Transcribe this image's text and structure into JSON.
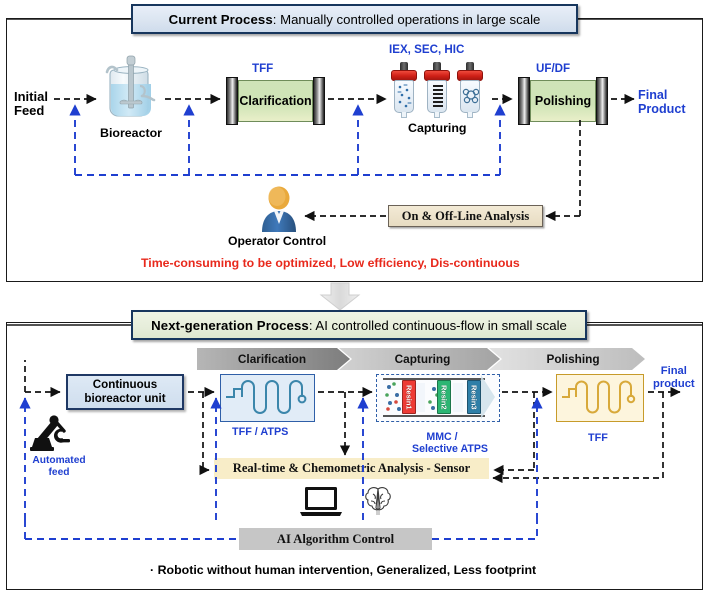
{
  "figure": {
    "title_top": "Current Process",
    "title_bottom": "Next-generation Process"
  },
  "top_panel": {
    "banner": {
      "title": "Current Process",
      "subtitle": ": Manually controlled operations in large scale"
    },
    "initial_feed": "Initial\nFeed",
    "initial_feed_line1": "Initial",
    "initial_feed_line2": "Feed",
    "bioreactor_label": "Bioreactor",
    "clarification": {
      "tag": "TFF",
      "label": "Clarification"
    },
    "capturing": {
      "tag": "IEX, SEC, HIC",
      "label": "Capturing"
    },
    "polishing": {
      "tag": "UF/DF",
      "label": "Polishing"
    },
    "final_product_line1": "Final",
    "final_product_line2": "Product",
    "analysis_box": "On & Off-Line Analysis",
    "operator_label": "Operator Control",
    "footnote": "Time-consuming to be optimized,  Low efficiency,  Dis-continuous"
  },
  "bottom_panel": {
    "banner": {
      "title": "Next-generation Process",
      "subtitle": ": AI controlled continuous-flow in small scale"
    },
    "stages": [
      "Clarification",
      "Capturing",
      "Polishing"
    ],
    "bioreactor_unit_line1": "Continuous",
    "bioreactor_unit_line2": "bioreactor unit",
    "automated_feed_line1": "Automated",
    "automated_feed_line2": "feed",
    "clarification_tag": "TFF / ATPS",
    "capture_tag_line1": "MMC /",
    "capture_tag_line2": "Selective ATPS",
    "resins": [
      {
        "label": "Resin1",
        "color": "#ee3b35"
      },
      {
        "label": "Resin2",
        "color": "#2cb673"
      },
      {
        "label": "Resin3",
        "color": "#2f7fa8"
      }
    ],
    "polishing_tag": "TFF",
    "final_product_line1": "Final",
    "final_product_line2": "product",
    "sensor_box": "Real-time & Chemometric Analysis - Sensor",
    "ai_box": "AI Algorithm  Control",
    "footnote": "· Robotic without human intervention,   Generalized,   Less footprint"
  },
  "colors": {
    "accent_blue": "#1f3fd0",
    "banner_border": "#17365d",
    "red_note": "#e8291c",
    "cassette_green": "#cfe3b8",
    "sensor_bg": "#f8edc8",
    "ai_bg": "#c6c6c6"
  }
}
